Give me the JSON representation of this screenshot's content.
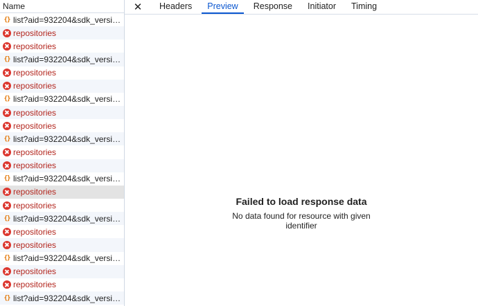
{
  "list": {
    "header": "Name",
    "rows": [
      {
        "type": "ok",
        "icon": "json-icon",
        "label": "list?aid=932204&sdk_version=..."
      },
      {
        "type": "error",
        "icon": "error-icon",
        "label": "repositories"
      },
      {
        "type": "error",
        "icon": "error-icon",
        "label": "repositories"
      },
      {
        "type": "ok",
        "icon": "json-icon",
        "label": "list?aid=932204&sdk_version=..."
      },
      {
        "type": "error",
        "icon": "error-icon",
        "label": "repositories"
      },
      {
        "type": "error",
        "icon": "error-icon",
        "label": "repositories"
      },
      {
        "type": "ok",
        "icon": "json-icon",
        "label": "list?aid=932204&sdk_version=..."
      },
      {
        "type": "error",
        "icon": "error-icon",
        "label": "repositories"
      },
      {
        "type": "error",
        "icon": "error-icon",
        "label": "repositories"
      },
      {
        "type": "ok",
        "icon": "json-icon",
        "label": "list?aid=932204&sdk_version=..."
      },
      {
        "type": "error",
        "icon": "error-icon",
        "label": "repositories"
      },
      {
        "type": "error",
        "icon": "error-icon",
        "label": "repositories"
      },
      {
        "type": "ok",
        "icon": "json-icon",
        "label": "list?aid=932204&sdk_version=..."
      },
      {
        "type": "error",
        "icon": "error-icon",
        "label": "repositories",
        "selected": true
      },
      {
        "type": "error",
        "icon": "error-icon",
        "label": "repositories"
      },
      {
        "type": "ok",
        "icon": "json-icon",
        "label": "list?aid=932204&sdk_version=..."
      },
      {
        "type": "error",
        "icon": "error-icon",
        "label": "repositories"
      },
      {
        "type": "error",
        "icon": "error-icon",
        "label": "repositories"
      },
      {
        "type": "ok",
        "icon": "json-icon",
        "label": "list?aid=932204&sdk_version=..."
      },
      {
        "type": "error",
        "icon": "error-icon",
        "label": "repositories"
      },
      {
        "type": "error",
        "icon": "error-icon",
        "label": "repositories"
      },
      {
        "type": "ok",
        "icon": "json-icon",
        "label": "list?aid=932204&sdk_version=..."
      }
    ]
  },
  "tabs": {
    "close_icon": "close-icon",
    "items": [
      "Headers",
      "Preview",
      "Response",
      "Initiator",
      "Timing"
    ],
    "active": "Preview"
  },
  "preview": {
    "title": "Failed to load response data",
    "description": "No data found for resource with given identifier"
  },
  "colors": {
    "accent": "#0b57d0",
    "error": "#dc362e",
    "error_text": "#b3261e",
    "json_icon": "#e37400",
    "selected_row": "#e3e3e3"
  }
}
